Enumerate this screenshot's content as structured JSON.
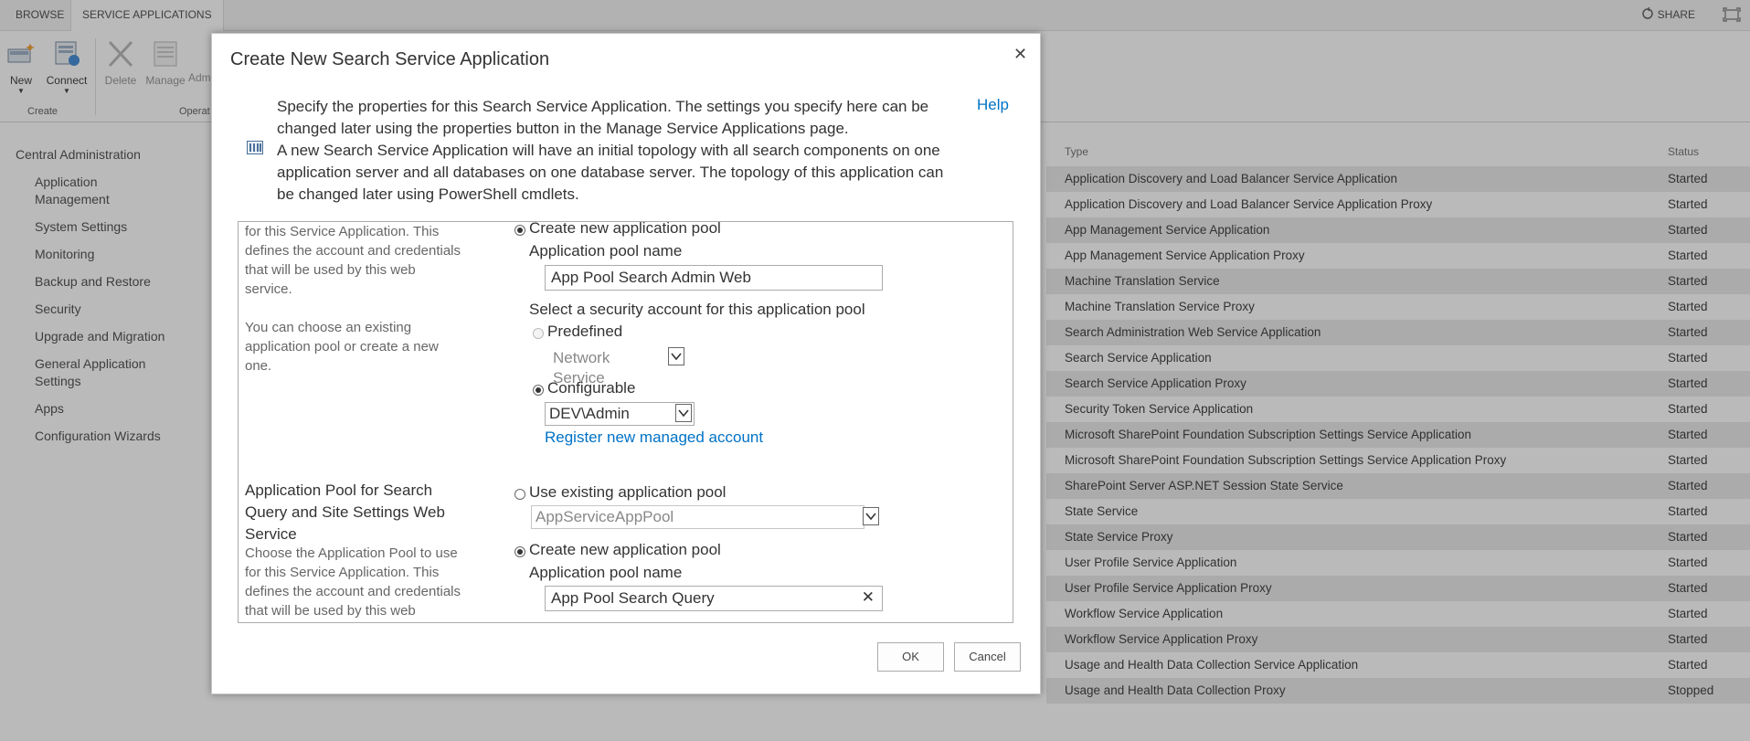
{
  "topbar": {
    "tabs": [
      "BROWSE",
      "SERVICE APPLICATIONS"
    ],
    "share": "SHARE"
  },
  "ribbon": {
    "buttons": [
      {
        "label": "New"
      },
      {
        "label": "Connect"
      },
      {
        "label": "Delete"
      },
      {
        "label": "Manage"
      },
      {
        "label": "Adm"
      }
    ],
    "groups": [
      "Create",
      "Operat"
    ]
  },
  "left_nav": {
    "header": "Central Administration",
    "items": [
      "Application Management",
      "System Settings",
      "Monitoring",
      "Backup and Restore",
      "Security",
      "Upgrade and Migration",
      "General Application Settings",
      "Apps",
      "Configuration Wizards"
    ]
  },
  "service_list": {
    "col_type": "Type",
    "col_status": "Status",
    "rows": [
      {
        "type": "Application Discovery and Load Balancer Service Application",
        "status": "Started"
      },
      {
        "type": "Application Discovery and Load Balancer Service Application Proxy",
        "status": "Started"
      },
      {
        "type": "App Management Service Application",
        "status": "Started"
      },
      {
        "type": "App Management Service Application Proxy",
        "status": "Started"
      },
      {
        "type": "Machine Translation Service",
        "status": "Started"
      },
      {
        "type": "Machine Translation Service Proxy",
        "status": "Started"
      },
      {
        "type": "Search Administration Web Service Application",
        "status": "Started"
      },
      {
        "type": "Search Service Application",
        "status": "Started"
      },
      {
        "type": "Search Service Application Proxy",
        "status": "Started"
      },
      {
        "type": "Security Token Service Application",
        "status": "Started"
      },
      {
        "type": "Microsoft SharePoint Foundation Subscription Settings Service Application",
        "status": "Started"
      },
      {
        "type": "Microsoft SharePoint Foundation Subscription Settings Service Application Proxy",
        "status": "Started"
      },
      {
        "type": "SharePoint Server ASP.NET Session State Service",
        "status": "Started"
      },
      {
        "type": "State Service",
        "status": "Started"
      },
      {
        "type": "State Service Proxy",
        "status": "Started"
      },
      {
        "type": "User Profile Service Application",
        "status": "Started"
      },
      {
        "type": "User Profile Service Application Proxy",
        "status": "Started"
      },
      {
        "type": "Workflow Service Application",
        "status": "Started"
      },
      {
        "type": "Workflow Service Application Proxy",
        "status": "Started"
      },
      {
        "type": "Usage and Health Data Collection Service Application",
        "status": "Started"
      },
      {
        "type": "Usage and Health Data Collection Proxy",
        "status": "Stopped"
      }
    ]
  },
  "dialog": {
    "title": "Create New Search Service Application",
    "intro_line1": "Specify the properties for this Search Service Application. The settings you specify here can be",
    "intro_line2": "changed later using the properties button in the Manage Service Applications page.",
    "intro_line3": "A new Search Service Application will have an initial topology with all search components on one",
    "intro_line4": "application server and all databases on one database server. The topology of this application can",
    "intro_line5": "be changed later using PowerShell cmdlets.",
    "help": "Help",
    "sec1_desc_lines": [
      "for this Service Application.  This",
      "defines the account and credentials",
      "that will be used by this web",
      "service."
    ],
    "sec1_desc2_lines": [
      "You can choose an existing",
      "application pool or create a new",
      "one."
    ],
    "create_pool_label": "Create new application pool",
    "pool_name_label": "Application pool name",
    "pool_name_value": "App Pool Search Admin Web",
    "security_account_label": "Select a security account for this application pool",
    "predefined_label": "Predefined",
    "predefined_value": "Network Service",
    "configurable_label": "Configurable",
    "configurable_value": "DEV\\Admin",
    "register_link": "Register new managed account",
    "sec2_title_lines": [
      "Application Pool for Search",
      "Query and Site Settings Web",
      "Service"
    ],
    "sec2_desc_lines": [
      "Choose the Application Pool to use",
      "for this Service Application.  This",
      "defines the account and credentials",
      "that will be used by this web"
    ],
    "use_existing_label": "Use existing application pool",
    "existing_pool_value": "AppServiceAppPool",
    "create_pool2_label": "Create new application pool",
    "pool_name2_label": "Application pool name",
    "pool_name2_value": "App Pool Search Query",
    "ok": "OK",
    "cancel": "Cancel"
  }
}
